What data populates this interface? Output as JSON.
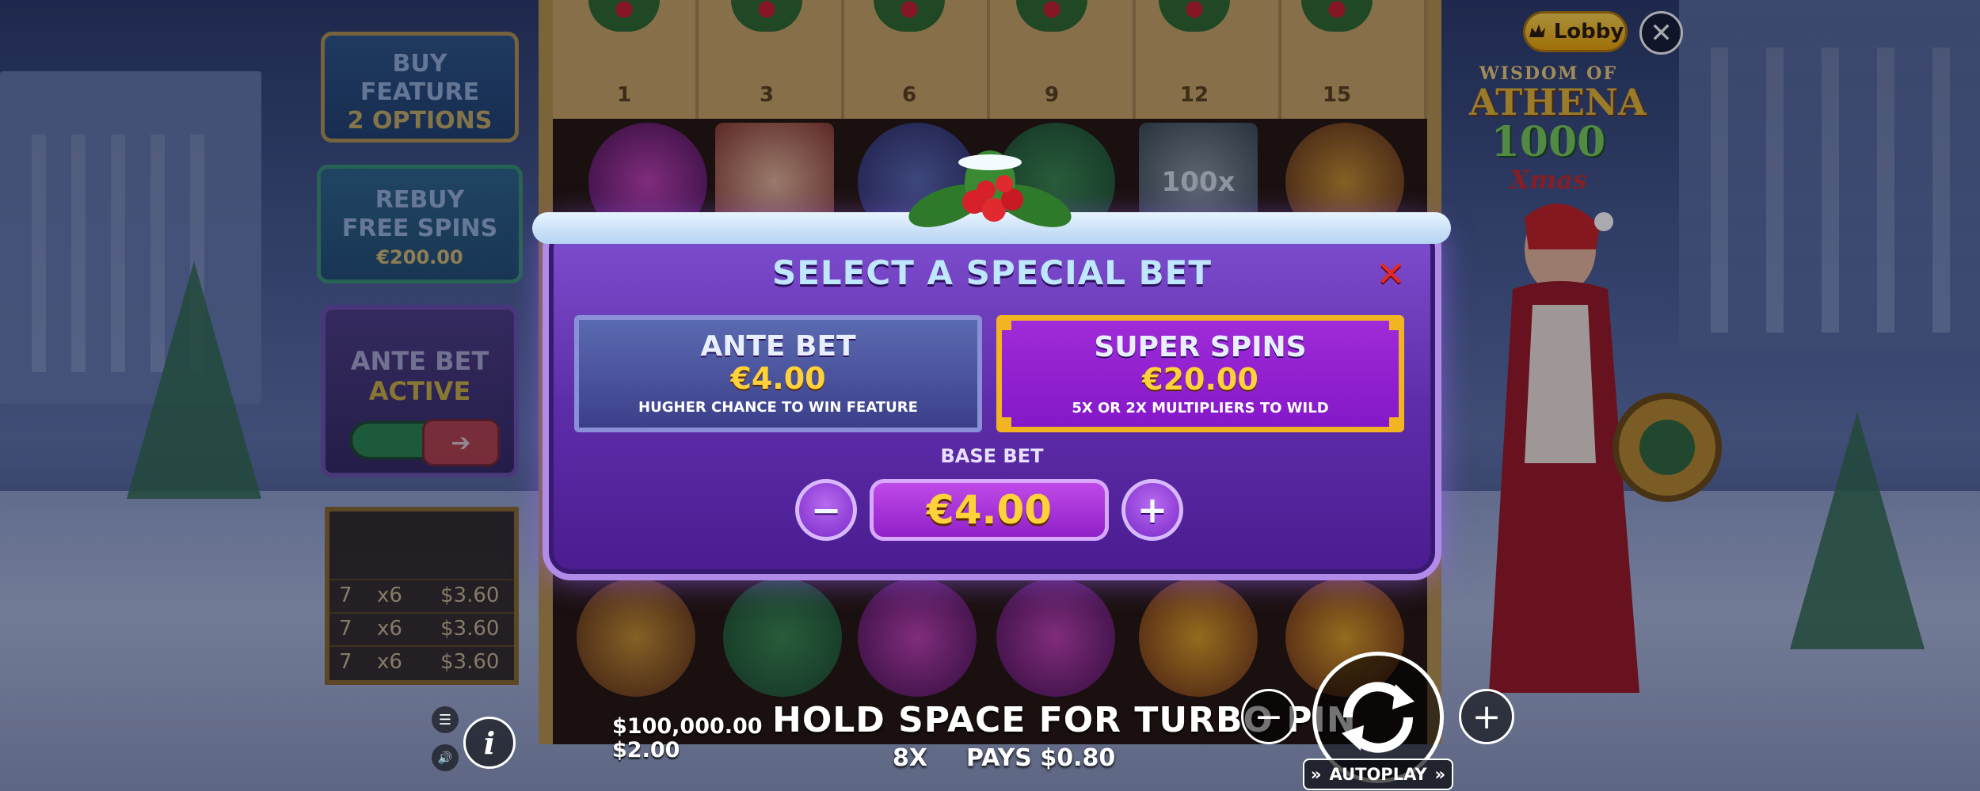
{
  "top": {
    "lobby_label": "Lobby",
    "lobby_icon": "crown-hand-icon",
    "close_icon": "close-icon"
  },
  "logo": {
    "line1": "WISDOM OF",
    "line2": "ATHENA",
    "line3": "1000",
    "line4": "Xmas"
  },
  "reels": {
    "header_numbers": [
      "1",
      "3",
      "6",
      "9",
      "12",
      "15"
    ],
    "row_top_symbols": [
      "helmet-gem",
      "scatter",
      "shield",
      "scroll",
      "100x",
      "spartan-helmet"
    ],
    "row_bottom_symbols": [
      "spartan-helmet",
      "scroll",
      "helmet-gem",
      "helmet-gem",
      "golden-helmet",
      "golden-helmet"
    ]
  },
  "side": {
    "buy_feature": {
      "line1": "BUY",
      "line2": "FEATURE",
      "line3": "2 OPTIONS"
    },
    "rebuy": {
      "line1": "REBUY",
      "line2": "FREE SPINS",
      "price": "€200.00"
    },
    "ante_bet": {
      "line1": "ANTE BET",
      "line2": "ACTIVE",
      "arrow": "➔"
    },
    "paytable": [
      {
        "count": "7",
        "mult": "x6",
        "amount": "$3.60"
      },
      {
        "count": "7",
        "mult": "x6",
        "amount": "$3.60"
      },
      {
        "count": "7",
        "mult": "x6",
        "amount": "$3.60"
      }
    ]
  },
  "modal": {
    "title": "SELECT A SPECIAL BET",
    "close_glyph": "✕",
    "options": [
      {
        "name": "ANTE BET",
        "price": "€4.00",
        "desc": "HUGHER CHANCE TO WIN FEATURE",
        "selected": false
      },
      {
        "name": "SUPER SPINS",
        "price": "€20.00",
        "desc": "5X OR 2X MULTIPLIERS TO WILD",
        "selected": true
      }
    ],
    "base_bet_label": "BASE BET",
    "base_bet_value": "€4.00",
    "minus_glyph": "−",
    "plus_glyph": "+"
  },
  "bottom": {
    "menu_glyph": "☰",
    "sound_glyph": "🔊",
    "info_glyph": "i",
    "credit": "$100,000.00",
    "bet": "$2.00",
    "message": "HOLD SPACE FOR TURBO   PIN",
    "win_multiplier": "8X",
    "win_pays": "PAYS $0.80",
    "bet_minus": "−",
    "bet_plus": "+",
    "autoplay_label": "AUTOPLAY",
    "autoplay_left": "»",
    "autoplay_right": "»"
  },
  "colors": {
    "modal_purple": "#6a3cc0",
    "gold": "#ffd23a",
    "selected_border": "#f2b420",
    "close_red": "#e02a2a",
    "title_blue": "#bfe8ff"
  }
}
